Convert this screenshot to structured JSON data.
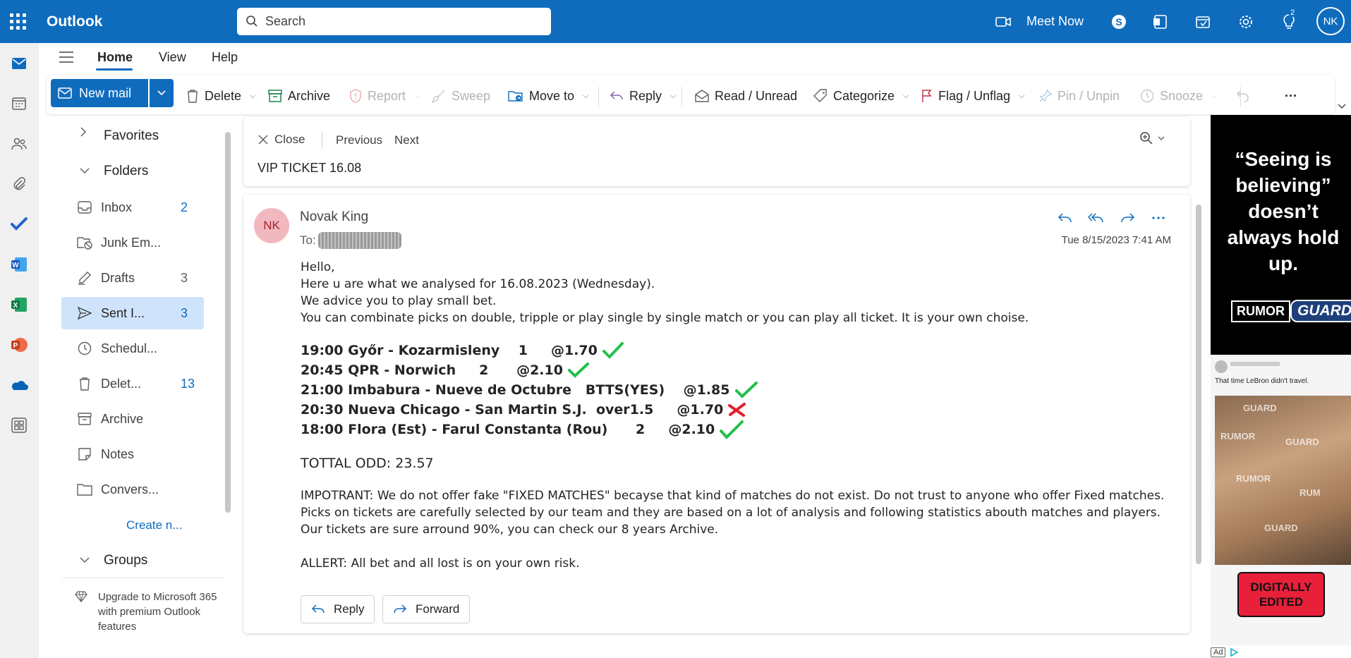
{
  "app": {
    "brand": "Outlook",
    "search_placeholder": "Search",
    "meet_now": "Meet Now",
    "notification_count": "2",
    "user_initials": "NK"
  },
  "tabs": [
    {
      "label": "Home"
    },
    {
      "label": "View"
    },
    {
      "label": "Help"
    }
  ],
  "ribbon": {
    "new_mail": "New mail",
    "delete": "Delete",
    "archive": "Archive",
    "report": "Report",
    "sweep": "Sweep",
    "move_to": "Move to",
    "reply": "Reply",
    "read_unread": "Read / Unread",
    "categorize": "Categorize",
    "flag_unflag": "Flag / Unflag",
    "pin_unpin": "Pin / Unpin",
    "snooze": "Snooze",
    "more": "···"
  },
  "folders": {
    "favorites": "Favorites",
    "folders": "Folders",
    "groups": "Groups",
    "create_new": "Create n...",
    "items": [
      {
        "label": "Inbox",
        "count": "2"
      },
      {
        "label": "Junk Em...",
        "count": ""
      },
      {
        "label": "Drafts",
        "count": "3"
      },
      {
        "label": "Sent I...",
        "count": "3"
      },
      {
        "label": "Schedul...",
        "count": ""
      },
      {
        "label": "Delet...",
        "count": "13"
      },
      {
        "label": "Archive",
        "count": ""
      },
      {
        "label": "Notes",
        "count": ""
      },
      {
        "label": "Convers...",
        "count": ""
      }
    ],
    "upgrade": "Upgrade to Microsoft 365 with premium Outlook features"
  },
  "reading": {
    "close": "Close",
    "previous": "Previous",
    "next": "Next",
    "subject": "VIP TICKET 16.08"
  },
  "message": {
    "sender_initials": "NK",
    "sender": "Novak King",
    "to_label": "To:",
    "date": "Tue 8/15/2023 7:41 AM",
    "greeting": "Hello,",
    "line1": "Here u are what we analysed for 16.08.2023 (Wednesday).",
    "line2": "We advice you to play small bet.",
    "line3": "You can combinate picks on double, tripple or play single by single match or you can play all ticket. It is your own choise.",
    "picks": [
      {
        "text": "19:00 Győr - Kozarmisleny    1     @1.70",
        "result": "win"
      },
      {
        "text": "20:45 QPR - Norwich     2      @2.10",
        "result": "win"
      },
      {
        "text": "21:00 Imbabura - Nueve de Octubre   BTTS(YES)    @1.85",
        "result": "win"
      },
      {
        "text": "20:30 Nueva Chicago - San Martin S.J.  over1.5     @1.70",
        "result": "loss"
      },
      {
        "text": "18:00 Flora (Est) - Farul Constanta (Rou)      2     @2.10",
        "result": "win"
      }
    ],
    "total_odd": "TOTTAL ODD: 23.57",
    "important": "IMPOTRANT: We do not offer fake \"FIXED MATCHES\" becayse that kind of matches do not exist. Do not trust to anyone who offer Fixed matches. Picks on tickets are carefully selected by our team and they are based on a lot of analysis and following statistics abouth matches and players. Our tickets are sure arround 90%, you can check our 8 years Archive.",
    "allert": "ALLERT: All bet and all lost is on your own risk.",
    "reply_btn": "Reply",
    "forward_btn": "Forward"
  },
  "ad": {
    "quote": "“Seeing is believing” doesn’t always hold up.",
    "brand_left": "RUMOR",
    "brand_right": "GUARD",
    "tweet_caption": "That time LeBron didn't travel.",
    "stamp": "DIGITALLY EDITED",
    "ad_label": "Ad"
  }
}
